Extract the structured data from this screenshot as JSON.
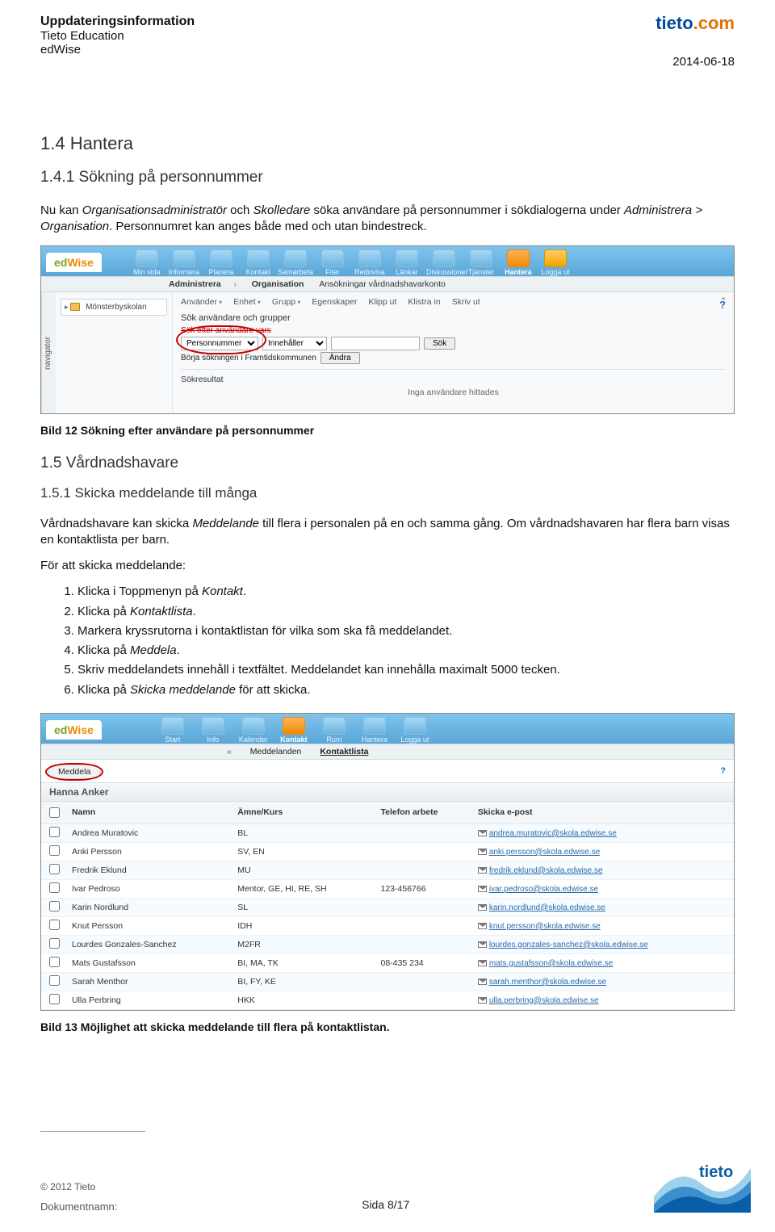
{
  "header": {
    "line1": "Uppdateringsinformation",
    "line2": "Tieto Education",
    "line3": "edWise",
    "brand": "tieto",
    "brand_suffix": ".com",
    "date": "2014-06-18"
  },
  "section_1_4": {
    "heading": "1.4 Hantera",
    "sub_heading": "1.4.1 Sökning på personnummer",
    "para1_pre": "Nu kan ",
    "para1_em1": "Organisationsadministratör",
    "para1_mid1": " och ",
    "para1_em2": "Skolledare",
    "para1_mid2": " söka användare på personnummer i sökdialogerna under ",
    "para1_em3": "Administrera > Organisation",
    "para1_tail": ". Personnumret kan anges både med och utan bindestreck."
  },
  "shot1": {
    "logo_ed": "ed",
    "logo_wise": "Wise",
    "topnav": [
      "Min sida",
      "Informera",
      "Planera",
      "Kontakt",
      "Samarbeta",
      "Filer",
      "Redovisa",
      "Länkar",
      "Diskussioner",
      "Tjänster",
      "Hantera",
      "Logga ut"
    ],
    "subnav": {
      "a": "Administrera",
      "b": "Organisation",
      "c": "Ansökningar vårdnadshavarkonto"
    },
    "navigator_tab": "navigator",
    "tree_root": "Mönsterbyskolan",
    "toolbar": [
      "Använder",
      "Enhet",
      "Grupp",
      "Egenskaper",
      "Klipp ut",
      "Klistra in",
      "Skriv ut"
    ],
    "search_label": "Sök användare och grupper",
    "red_strike": "Sök efter användare vars",
    "dropdown_pn": "Personnummer",
    "dropdown_op": "Innehåller",
    "btn_sok": "Sök",
    "start_label": "Börja sökningen i Framtidskommunen",
    "btn_andra": "Ändra",
    "sokresultat": "Sökresultat",
    "no_user": "Inga användare hittades"
  },
  "caption1": "Bild 12 Sökning efter användare på personnummer",
  "section_1_5": {
    "heading": "1.5 Vårdnadshavare",
    "sub_heading": "1.5.1 Skicka meddelande till många",
    "para_pre": "Vårdnadshavare kan skicka ",
    "para_em": "Meddelande",
    "para_tail": " till flera i personalen på en och samma gång. Om vårdnadshavaren har flera barn visas en kontaktlista per barn.",
    "steps_intro": "För att skicka meddelande:",
    "steps": [
      {
        "pre": "Klicka i Toppmenyn på ",
        "em": "Kontakt",
        "post": "."
      },
      {
        "pre": "Klicka på ",
        "em": "Kontaktlista",
        "post": "."
      },
      {
        "pre": "Markera kryssrutorna i kontaktlistan för vilka som ska få meddelandet.",
        "em": "",
        "post": ""
      },
      {
        "pre": "Klicka på ",
        "em": "Meddela",
        "post": "."
      },
      {
        "pre": "Skriv meddelandets innehåll i textfältet. Meddelandet kan innehålla maximalt 5000 tecken.",
        "em": "",
        "post": ""
      },
      {
        "pre": "Klicka på ",
        "em": "Skicka meddelande",
        "post": " för att skicka."
      }
    ]
  },
  "shot2": {
    "topnav": [
      "Start",
      "Info",
      "Kalender",
      "Kontakt",
      "Rum",
      "Hantera",
      "Logga ut"
    ],
    "subnav": {
      "a": "Meddelanden",
      "b": "Kontaktlista"
    },
    "meddela": "Meddela",
    "listname": "Hanna Anker",
    "th": [
      "",
      "Namn",
      "Ämne/Kurs",
      "Telefon arbete",
      "Skicka e-post"
    ],
    "rows": [
      {
        "name": "Andrea Muratovic",
        "subj": "BL",
        "tel": "",
        "email": "andrea.muratovic@skola.edwise.se"
      },
      {
        "name": "Anki Persson",
        "subj": "SV, EN",
        "tel": "",
        "email": "anki.persson@skola.edwise.se"
      },
      {
        "name": "Fredrik Eklund",
        "subj": "MU",
        "tel": "",
        "email": "fredrik.eklund@skola.edwise.se"
      },
      {
        "name": "Ivar Pedroso",
        "subj": "Mentor, GE, HI, RE, SH",
        "tel": "123-456766",
        "email": "ivar.pedroso@skola.edwise.se"
      },
      {
        "name": "Karin Nordlund",
        "subj": "SL",
        "tel": "",
        "email": "karin.nordlund@skola.edwise.se"
      },
      {
        "name": "Knut Persson",
        "subj": "IDH",
        "tel": "",
        "email": "knut.persson@skola.edwise.se"
      },
      {
        "name": "Lourdes Gonzales-Sanchez",
        "subj": "M2FR",
        "tel": "",
        "email": "lourdes.gonzales-sanchez@skola.edwise.se"
      },
      {
        "name": "Mats Gustafsson",
        "subj": "BI, MA, TK",
        "tel": "08-435 234",
        "email": "mats.gustafsson@skola.edwise.se"
      },
      {
        "name": "Sarah Menthor",
        "subj": "BI, FY, KE",
        "tel": "",
        "email": "sarah.menthor@skola.edwise.se"
      },
      {
        "name": "Ulla Perbring",
        "subj": "HKK",
        "tel": "",
        "email": "ulla.perbring@skola.edwise.se"
      }
    ]
  },
  "caption2": "Bild 13 Möjlighet att skicka meddelande till flera på kontaktlistan.",
  "footer": {
    "copyright": "© 2012 Tieto",
    "dokumentnamn": "Dokumentnamn:",
    "page": "Sida 8/17"
  }
}
